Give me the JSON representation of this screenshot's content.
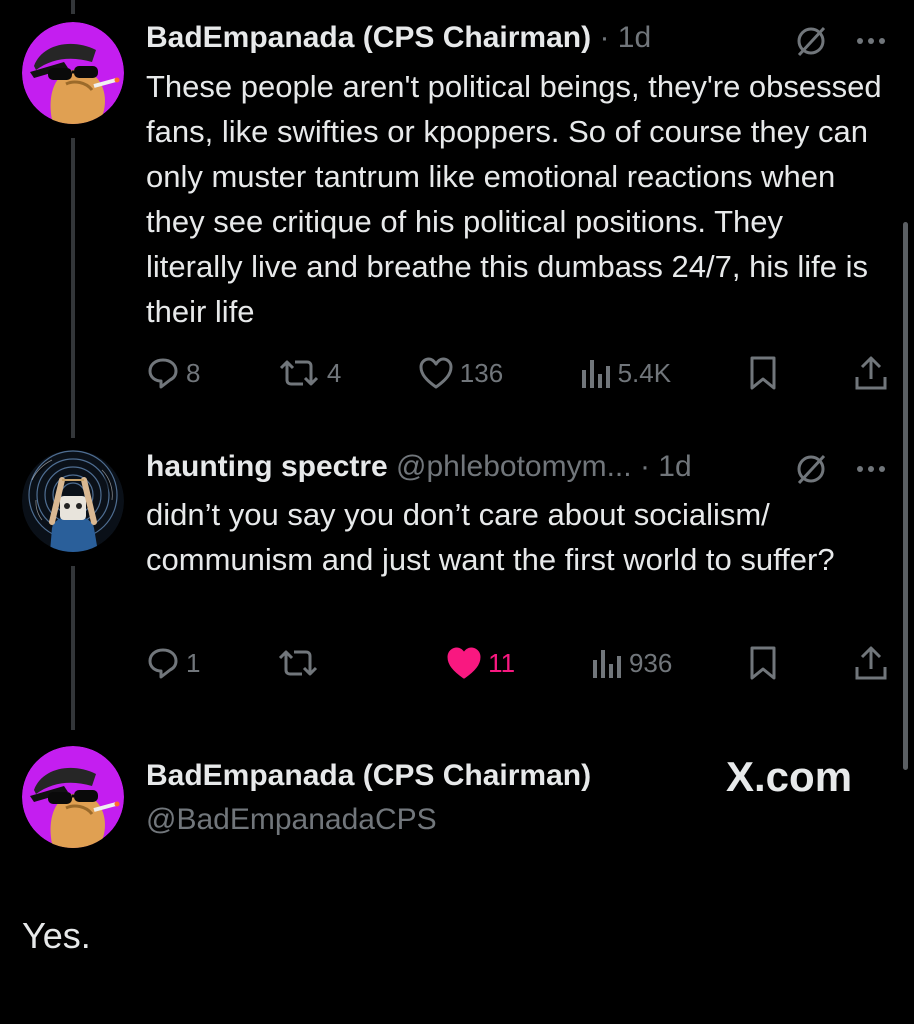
{
  "tweet1": {
    "display_name": "BadEmpanada (CPS Chairman)",
    "separator": "·",
    "time": "1d",
    "text": "These people aren't political beings, they're obsessed fans, like swifties or kpoppers. So of course they can only muster tantrum like emotional reactions  when they see critique of his political positions. They literally live and breathe this dumbass 24/7, his life is their life",
    "replies": "8",
    "reposts": "4",
    "likes": "136",
    "views": "5.4K",
    "liked": false
  },
  "tweet2": {
    "display_name": "haunting spectre",
    "handle": "@phlebotomym...",
    "separator": "·",
    "time": "1d",
    "text": "didn’t you say you don’t care about socialism/ communism and just want the first world to suffer?",
    "replies": "1",
    "reposts": "",
    "likes": "11",
    "views": "936",
    "liked": true
  },
  "final_post": {
    "display_name": "BadEmpanada (CPS Chairman)",
    "handle": "@BadEmpanadaCPS",
    "brand": "X.com",
    "text": "Yes."
  },
  "colors": {
    "background": "#000000",
    "text_primary": "#e7e9ea",
    "text_secondary": "#71767b",
    "like_active": "#f91880",
    "avatar_bg": "#c41ef0"
  },
  "icons": {
    "reply": "reply-bubble-icon",
    "repost": "repost-arrows-icon",
    "like": "heart-icon",
    "views": "bar-chart-icon",
    "bookmark": "bookmark-icon",
    "share": "share-upload-icon",
    "grok": "grok-slash-icon",
    "more": "more-dots-icon"
  }
}
